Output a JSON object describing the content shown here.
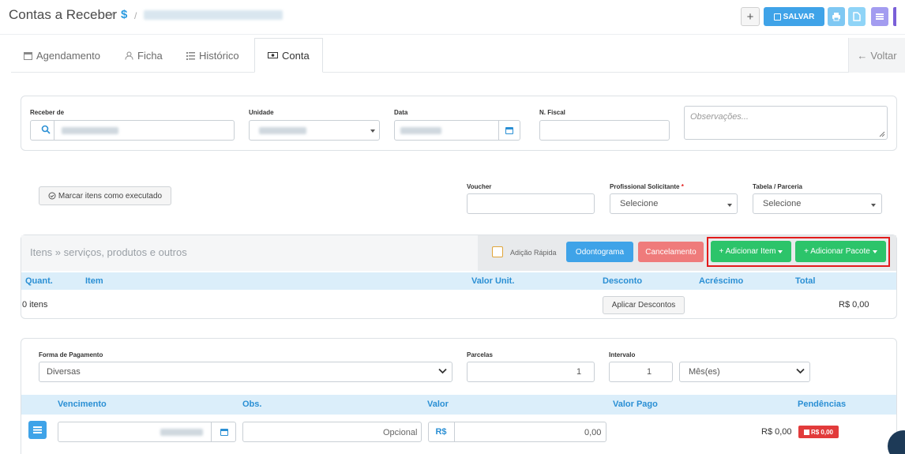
{
  "header": {
    "title": "Contas a Receber",
    "breadcrumb_sep": "/",
    "breadcrumb_symbol": "$",
    "plus_label": "+",
    "save_label": "SALVAR"
  },
  "tabs": [
    {
      "label": "Agendamento",
      "icon": "calendar-icon"
    },
    {
      "label": "Ficha",
      "icon": "user-icon"
    },
    {
      "label": "Histórico",
      "icon": "list-icon"
    },
    {
      "label": "Conta",
      "icon": "money-icon"
    }
  ],
  "voltar_label": "Voltar",
  "receber": {
    "receber_de_label": "Receber de",
    "unidade_label": "Unidade",
    "data_label": "Data",
    "nfiscal_label": "N. Fiscal",
    "observacoes_placeholder": "Observações..."
  },
  "exec": {
    "marcar_label": "Marcar itens como executado",
    "voucher_label": "Voucher",
    "profissional_label": "Profissional Solicitante",
    "required_mark": "*",
    "profissional_value": "Selecione",
    "tabela_label": "Tabela / Parceria",
    "tabela_value": "Selecione"
  },
  "items": {
    "placeholder": "Itens » serviços, produtos e outros",
    "adicao_rapida": "Adição Rápida",
    "odontograma": "Odontograma",
    "cancelamento": "Cancelamento",
    "adicionar_item": "+ Adicionar Item",
    "adicionar_pacote": "+ Adicionar Pacote",
    "headers": [
      "Quant.",
      "Item",
      "Valor Unit.",
      "Desconto",
      "Acréscimo",
      "Total"
    ],
    "count": "0 itens",
    "aplicar_descontos": "Aplicar Descontos",
    "total": "R$ 0,00"
  },
  "payment": {
    "forma_label": "Forma de Pagamento",
    "forma_value": "Diversas",
    "parcelas_label": "Parcelas",
    "parcelas_value": "1",
    "intervalo_label": "Intervalo",
    "intervalo_value": "1",
    "periodo_value": "Mês(es)",
    "headers": [
      "Vencimento",
      "Obs.",
      "Valor",
      "Valor Pago",
      "Pendências"
    ],
    "obs_placeholder": "Opcional",
    "currency": "R$",
    "valor": "0,00",
    "pendencia_value": "R$ 0,00",
    "pendencia_badge": "R$ 0,00"
  },
  "colors": {
    "accent": "#2a8fd4",
    "save": "#3fa3e8",
    "odontograma": "#3fa3e8",
    "cancelamento": "#ef7b7b",
    "add": "#2cc46a",
    "highlight": "#e21b1b",
    "badge": "#e23b3b"
  }
}
